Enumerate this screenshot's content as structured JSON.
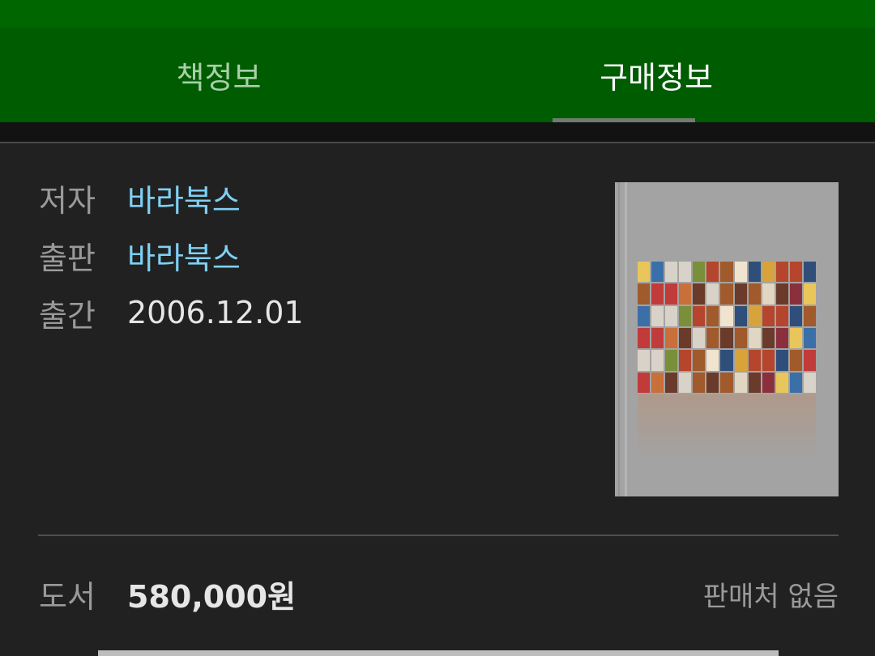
{
  "tabs": {
    "book_info": "책정보",
    "purchase_info": "구매정보",
    "selected": "purchase_info"
  },
  "details": {
    "author_label": "저자",
    "author_value": "바라북스",
    "publisher_label": "출판",
    "publisher_value": "바라북스",
    "release_label": "출간",
    "release_value": "2006.12.01"
  },
  "cover": {
    "icon": "book-cover-image"
  },
  "price": {
    "type_label": "도서",
    "amount": "580,000원",
    "seller_status": "판매처 없음"
  },
  "colors": {
    "header": "#005c00",
    "link": "#7fd0f4",
    "background": "#212121"
  }
}
